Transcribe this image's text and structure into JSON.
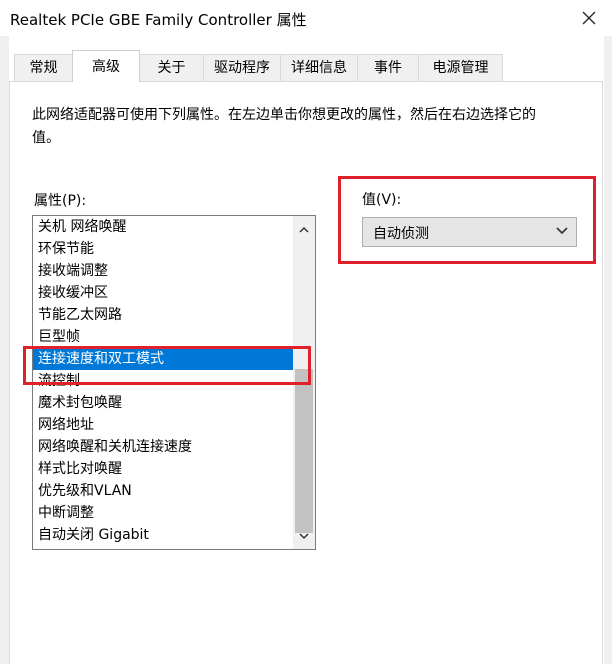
{
  "window": {
    "title": "Realtek PCIe GBE Family Controller 属性"
  },
  "tabs": [
    {
      "label": "常规"
    },
    {
      "label": "高级"
    },
    {
      "label": "关于"
    },
    {
      "label": "驱动程序"
    },
    {
      "label": "详细信息"
    },
    {
      "label": "事件"
    },
    {
      "label": "电源管理"
    }
  ],
  "advanced": {
    "description": "此网络适配器可使用下列属性。在左边单击你想更改的属性，然后在右边选择它的值。",
    "property_label": "属性(P):",
    "value_label": "值(V):",
    "properties": [
      "关机 网络唤醒",
      "环保节能",
      "接收端调整",
      "接收缓冲区",
      "节能乙太网路",
      "巨型帧",
      "连接速度和双工模式",
      "流控制",
      "魔术封包唤醒",
      "网络地址",
      "网络唤醒和关机连接速度",
      "样式比对唤醒",
      "优先级和VLAN",
      "中断调整",
      "自动关闭 Gigabit"
    ],
    "selected_property": "连接速度和双工模式",
    "value_selected": "自动侦测"
  },
  "icons": {
    "close": "close-icon",
    "scroll_up": "chevron-up-icon",
    "scroll_down": "chevron-down-icon",
    "dropdown": "chevron-down-icon"
  },
  "colors": {
    "selection": "#0078d7",
    "highlight_annotation": "#e0202a",
    "combo_bg": "#e5e5e5"
  }
}
